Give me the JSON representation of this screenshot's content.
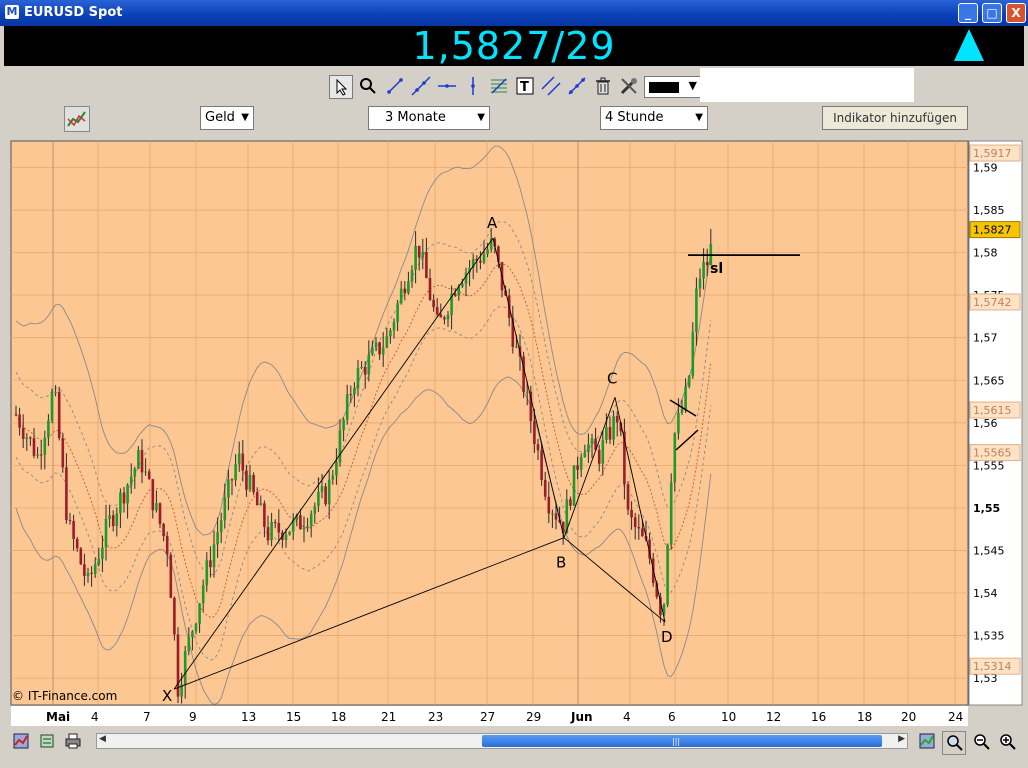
{
  "window": {
    "title": "EURUSD Spot",
    "app_icon": "M",
    "buttons": {
      "minimize": "_",
      "maximize": "□",
      "close": "X"
    }
  },
  "ticker": {
    "price": "1,5827/29",
    "direction_icon": "up-arrow-icon"
  },
  "toolbar": {
    "tools": [
      "cursor-icon",
      "zoom-icon",
      "line-icon",
      "ray-icon",
      "horizontal-line-icon",
      "vertical-line-icon",
      "fibonacci-icon",
      "text-icon",
      "channel-icon",
      "pitchfork-icon",
      "trash-icon",
      "properties-icon"
    ],
    "line_color": "#000000"
  },
  "controls": {
    "price_type": "Geld",
    "period": "3 Monate",
    "interval": "4 Stunde",
    "add_indicator": "Indikator hinzufügen"
  },
  "chart": {
    "copyright": "© IT-Finance.com",
    "background": "#fcc793",
    "y_ticks": [
      "1,59",
      "1,585",
      "1,58",
      "1,575",
      "1,57",
      "1,565",
      "1,56",
      "1,555",
      "1,55",
      "1,545",
      "1,54",
      "1,535",
      "1,53"
    ],
    "x_ticks": [
      "Mai",
      "4",
      "7",
      "9",
      "13",
      "15",
      "18",
      "21",
      "23",
      "27",
      "29",
      "Jun",
      "4",
      "6",
      "10",
      "12",
      "16",
      "18",
      "20",
      "24"
    ],
    "price_tags": [
      {
        "label": "1,5917",
        "style": "faded"
      },
      {
        "label": "1,5827",
        "style": "current"
      },
      {
        "label": "1,5742",
        "style": "faded"
      },
      {
        "label": "1,5615",
        "style": "faded"
      },
      {
        "label": "1,5565",
        "style": "faded"
      },
      {
        "label": "1,5314",
        "style": "faded"
      }
    ],
    "pattern_points": [
      {
        "label": "X",
        "date": "8 Mai",
        "price": 1.5287
      },
      {
        "label": "A",
        "date": "27 Mai",
        "price": 1.5817
      },
      {
        "label": "B",
        "date": "1 Jun",
        "price": 1.5465
      },
      {
        "label": "C",
        "date": "3 Jun",
        "price": 1.563
      },
      {
        "label": "D",
        "date": "5 Jun",
        "price": 1.5366
      }
    ],
    "sl_label": "sl",
    "sl_level": 1.5797
  },
  "bottombar": {
    "icons": [
      "chart-settings-icon",
      "export-icon",
      "print-icon",
      "zoom-fit-icon",
      "zoom-out-icon",
      "zoom-in-icon"
    ]
  }
}
